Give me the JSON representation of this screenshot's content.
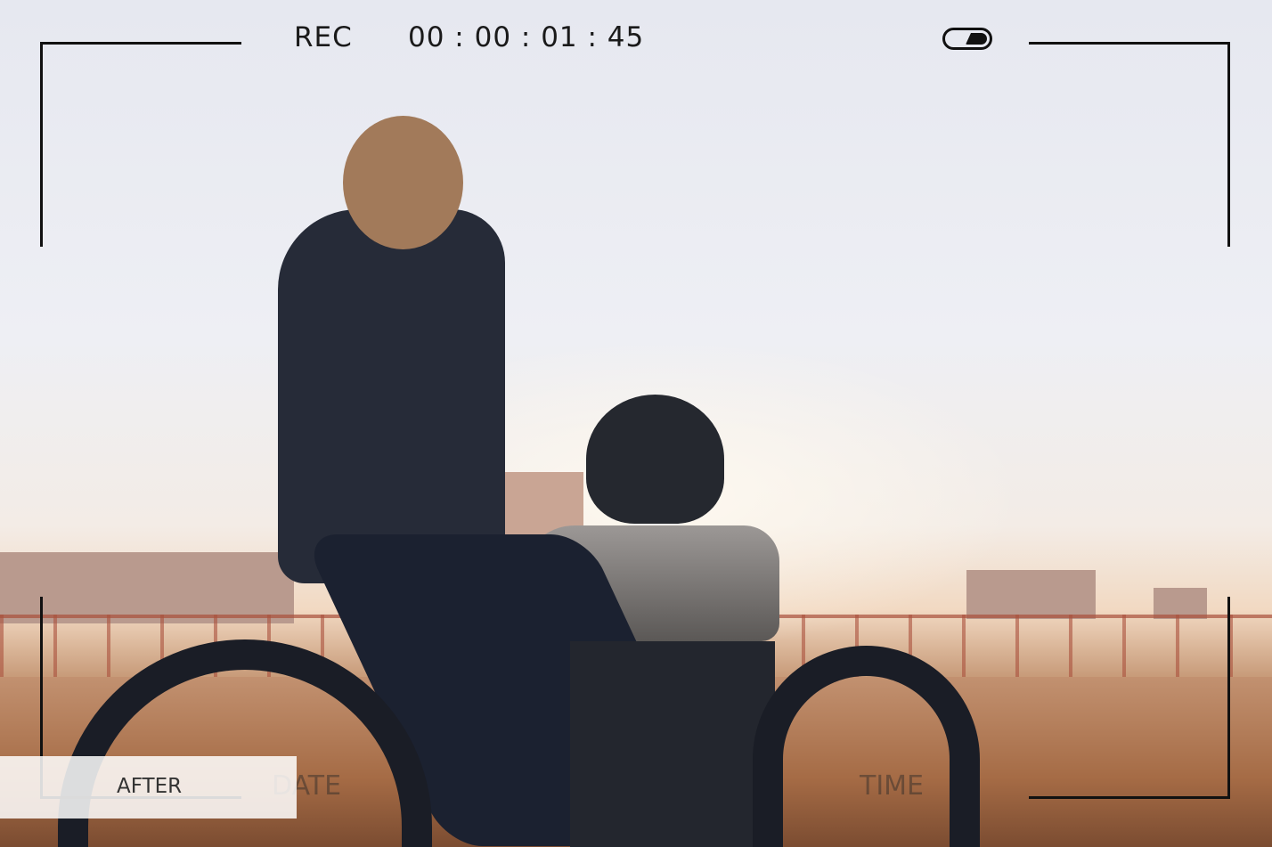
{
  "viewfinder": {
    "rec_label": "REC",
    "timecode": "00 : 00 : 01 : 45",
    "battery_level": 0.5,
    "date_label": "DATE",
    "time_label": "TIME"
  },
  "overlay": {
    "after_label": "AFTER"
  }
}
